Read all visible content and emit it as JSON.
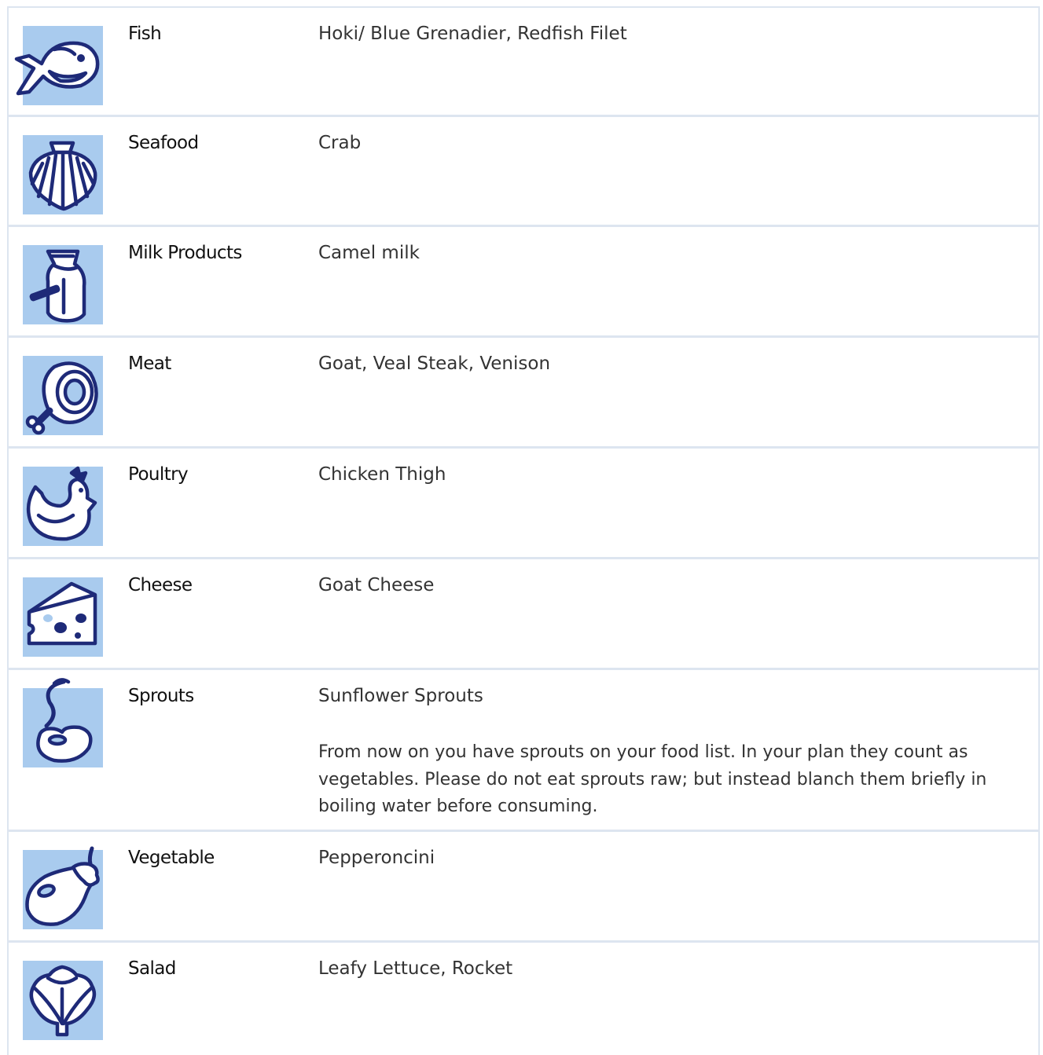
{
  "rows": [
    {
      "category": "Fish",
      "items": "Hoki/ Blue Grenadier, Redfish Filet",
      "icon": "fish-icon"
    },
    {
      "category": "Seafood",
      "items": "Crab",
      "icon": "shell-icon"
    },
    {
      "category": "Milk Products",
      "items": "Camel milk",
      "icon": "milk-can-icon"
    },
    {
      "category": "Meat",
      "items": "Goat, Veal Steak, Venison",
      "icon": "ham-icon"
    },
    {
      "category": "Poultry",
      "items": "Chicken Thigh",
      "icon": "chicken-icon"
    },
    {
      "category": "Cheese",
      "items": "Goat Cheese",
      "icon": "cheese-icon"
    },
    {
      "category": "Sprouts",
      "items": "Sunflower Sprouts",
      "note": "From now on you have sprouts on your food list. In your plan they count as vegetables. Please do not eat sprouts raw; but instead blanch them briefly in boiling water before consuming.",
      "icon": "sprout-icon"
    },
    {
      "category": "Vegetable",
      "items": "Pepperoncini",
      "icon": "eggplant-icon"
    },
    {
      "category": "Salad",
      "items": "Leafy Lettuce, Rocket",
      "icon": "lettuce-icon"
    }
  ],
  "colors": {
    "icon_background": "#a9cbee",
    "icon_stroke": "#1e2a78",
    "icon_fill": "#ffffff",
    "divider": "#dde5f0"
  }
}
